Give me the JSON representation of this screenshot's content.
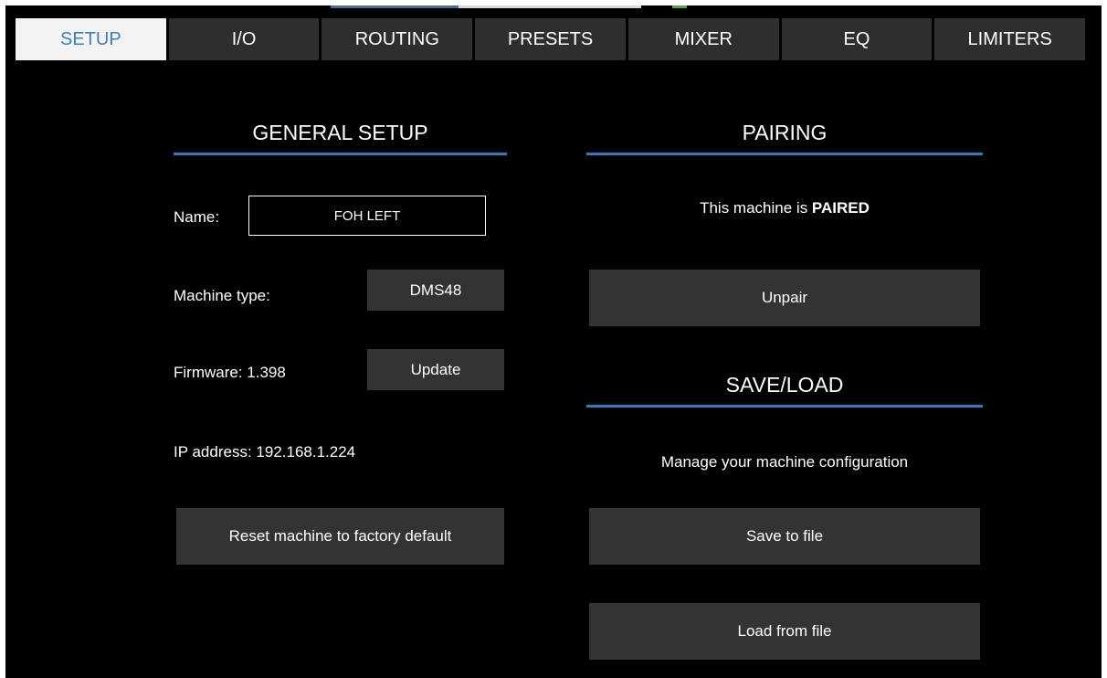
{
  "colors": {
    "accent": "#2f7bbf",
    "tab_active_text": "#3e7fc1",
    "button_bg": "#333333"
  },
  "tabs": [
    {
      "label": "SETUP",
      "active": true
    },
    {
      "label": "I/O"
    },
    {
      "label": "ROUTING"
    },
    {
      "label": "PRESETS"
    },
    {
      "label": "MIXER"
    },
    {
      "label": "EQ"
    },
    {
      "label": "LIMITERS"
    }
  ],
  "general": {
    "title": "GENERAL SETUP",
    "name_label": "Name:",
    "name_value": "FOH LEFT",
    "machine_type_label": "Machine type:",
    "machine_type_value": "DMS48",
    "firmware_label": "Firmware:  1.398",
    "update_label": "Update",
    "ip_label": "IP address:  192.168.1.224",
    "reset_label": "Reset machine to factory default"
  },
  "pairing": {
    "title": "PAIRING",
    "status_prefix": "This machine is ",
    "status_value": "PAIRED",
    "unpair_label": "Unpair"
  },
  "saveload": {
    "title": "SAVE/LOAD",
    "description": "Manage your machine configuration",
    "save_label": "Save to file",
    "load_label": "Load from file"
  }
}
